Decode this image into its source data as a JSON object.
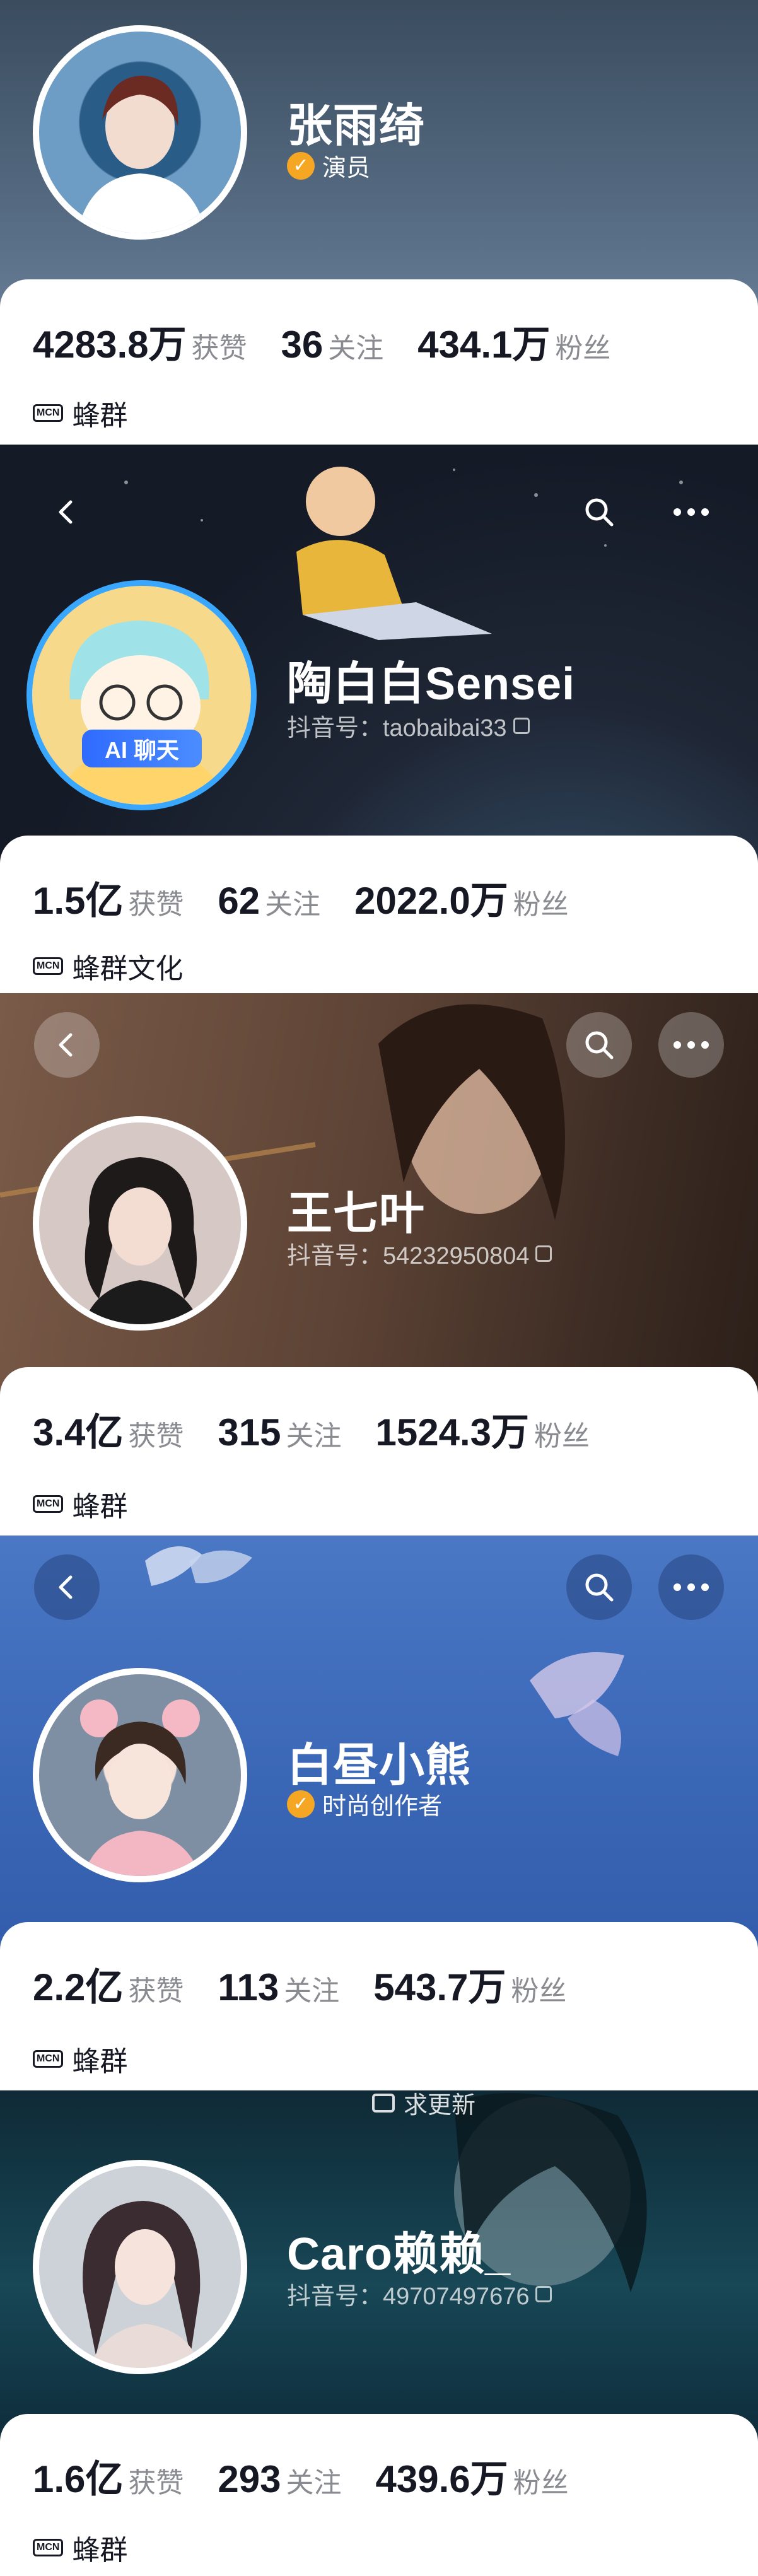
{
  "profiles": [
    {
      "name": "张雨绮",
      "badge": "演员",
      "likes": "4283.8万",
      "likes_label": "获赞",
      "following": "36",
      "following_label": "关注",
      "fans": "434.1万",
      "fans_label": "粉丝",
      "mcn_tag": "MCN",
      "mcn": "蜂群"
    },
    {
      "name": "陶白白Sensei",
      "account": "抖音号：taobaibai33",
      "ai_tag": "AI 聊天",
      "likes": "1.5亿",
      "likes_label": "获赞",
      "following": "62",
      "following_label": "关注",
      "fans": "2022.0万",
      "fans_label": "粉丝",
      "mcn_tag": "MCN",
      "mcn": "蜂群文化"
    },
    {
      "name": "王七叶",
      "account": "抖音号：54232950804",
      "likes": "3.4亿",
      "likes_label": "获赞",
      "following": "315",
      "following_label": "关注",
      "fans": "1524.3万",
      "fans_label": "粉丝",
      "mcn_tag": "MCN",
      "mcn": "蜂群"
    },
    {
      "name": "白昼小熊",
      "badge": "时尚创作者",
      "likes": "2.2亿",
      "likes_label": "获赞",
      "following": "113",
      "following_label": "关注",
      "fans": "543.7万",
      "fans_label": "粉丝",
      "mcn_tag": "MCN",
      "mcn": "蜂群"
    },
    {
      "name": "Caro赖赖_",
      "account": "抖音号：49707497676",
      "top_hint": "求更新",
      "likes": "1.6亿",
      "likes_label": "获赞",
      "following": "293",
      "following_label": "关注",
      "fans": "439.6万",
      "fans_label": "粉丝",
      "mcn_tag": "MCN",
      "mcn": "蜂群"
    }
  ],
  "icons": {
    "back": "chevron-left-icon",
    "search": "search-icon",
    "more": "more-horizontal-icon",
    "verified": "verified-check-icon",
    "copy": "copy-icon"
  },
  "colors": {
    "verified": "#f5a623",
    "ai_tag": "#2f6bff",
    "text_primary": "#161823",
    "text_secondary": "#8a8b91"
  }
}
